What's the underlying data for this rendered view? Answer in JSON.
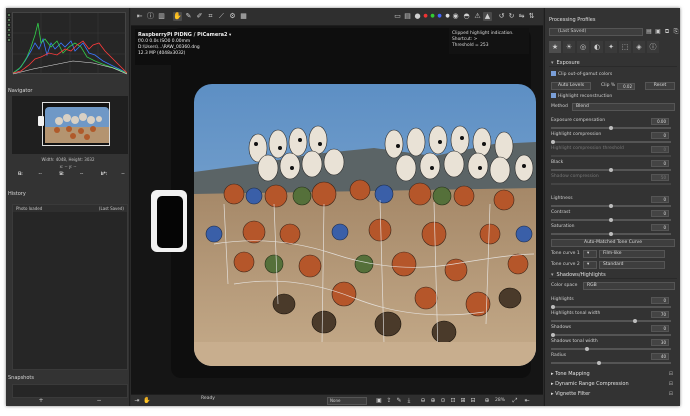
{
  "left": {
    "navigator_title": "Navigator",
    "nav_size": "Width: 4048, Height: 3032",
    "nav_coords": "x: -- y: --",
    "rgb_rows": [
      [
        "R:",
        "--",
        "H:",
        "--",
        "L*:",
        "--"
      ],
      [
        "G:",
        "--",
        "S:",
        "--",
        "a*:",
        "--"
      ],
      [
        "B:",
        "--",
        "V:",
        "--",
        "b*:",
        "--"
      ]
    ],
    "history_title": "History",
    "history_items": [
      {
        "label": "Photo loaded",
        "state": "(Last Saved)"
      }
    ],
    "snapshots_title": "Snapshots",
    "snap_add": "+",
    "snap_remove": "−"
  },
  "center": {
    "file_title": "RaspberryPi PiDNG / PiCamera2",
    "exif_line": "f/0.0  0.0s  ISO0  0.00mm",
    "path_line": "D:\\Users\\...\\RAW_00360.dng",
    "mp_line": "12.3 MP (4048x3032)",
    "tooltip_hl_line1": "Clipped highlight indication.",
    "tooltip_hl_line2": "Shortcut: >",
    "tooltip_hl_line3": "Threshold = 253",
    "status_ready": "Ready",
    "status_select": "None",
    "zoom": "28%"
  },
  "right": {
    "title": "Processing Profiles",
    "profile": "(Last Saved)",
    "exposure": {
      "title": "Exposure",
      "clip_oog": "Clip out-of-gamut colors",
      "auto_levels": "Auto Levels",
      "clip_label": "Clip %",
      "clip_value": "0.02",
      "reset": "Reset",
      "hl_recon": "Highlight reconstruction",
      "method_label": "Method",
      "method_value": "Blend",
      "exp_comp_label": "Exposure compensation",
      "exp_comp_value": "0.00",
      "hl_comp_label": "Highlight compression",
      "hl_comp_value": "0",
      "hl_thresh_label": "Highlight compression threshold",
      "hl_thresh_value": "0",
      "black_label": "Black",
      "black_value": "0",
      "shadow_comp_label": "Shadow compression",
      "shadow_comp_value": "50",
      "lightness_label": "Lightness",
      "lightness_value": "0",
      "contrast_label": "Contrast",
      "contrast_value": "0",
      "saturation_label": "Saturation",
      "saturation_value": "0",
      "auto_tone": "Auto-Matched Tone Curve",
      "tone1_label": "Tone curve 1",
      "tone1_value": "Film-like",
      "tone2_label": "Tone curve 2",
      "tone2_value": "Standard"
    },
    "shadows": {
      "title": "Shadows/Highlights",
      "colorspace_label": "Color space",
      "colorspace_value": "RGB",
      "highlights_label": "Highlights",
      "highlights_value": "0",
      "hl_tw_label": "Highlights tonal width",
      "hl_tw_value": "70",
      "shadows_label": "Shadows",
      "shadows_value": "0",
      "sh_tw_label": "Shadows tonal width",
      "sh_tw_value": "30",
      "radius_label": "Radius",
      "radius_value": "40"
    },
    "collapsed": [
      "Tone Mapping",
      "Dynamic Range Compression",
      "Vignette Filter"
    ]
  }
}
